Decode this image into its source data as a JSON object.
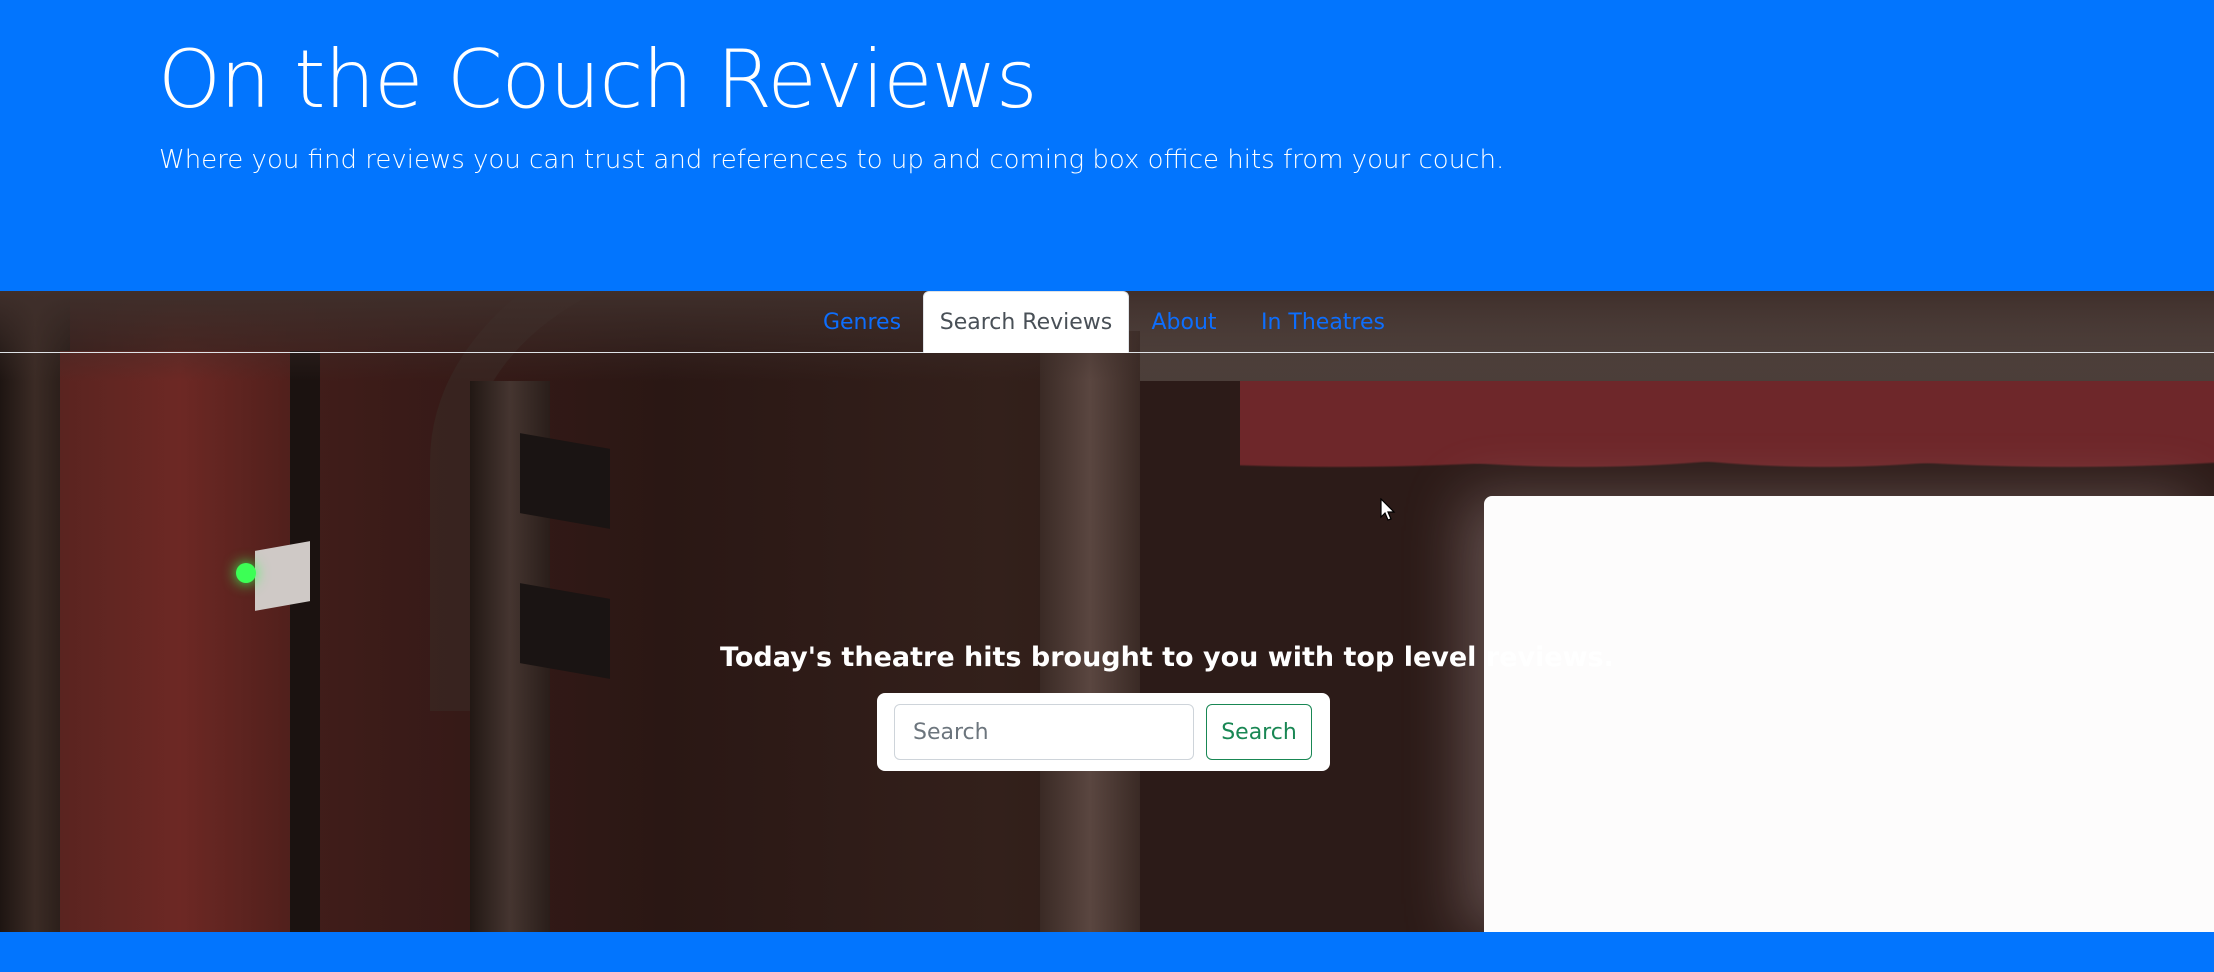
{
  "header": {
    "title": "On the Couch Reviews",
    "subtitle": "Where you find reviews you can trust and references to up and coming box office hits from your couch."
  },
  "nav": {
    "tabs": [
      {
        "label": "Genres",
        "active": false
      },
      {
        "label": "Search Reviews",
        "active": true
      },
      {
        "label": "About",
        "active": false
      },
      {
        "label": "In Theatres",
        "active": false
      }
    ]
  },
  "hero": {
    "tagline": "Today's theatre hits brought to you with top level reviews."
  },
  "search": {
    "placeholder": "Search",
    "button_label": "Search"
  },
  "colors": {
    "brand_blue": "#0275fe",
    "link_blue": "#0d6efd",
    "button_green": "#198754"
  }
}
